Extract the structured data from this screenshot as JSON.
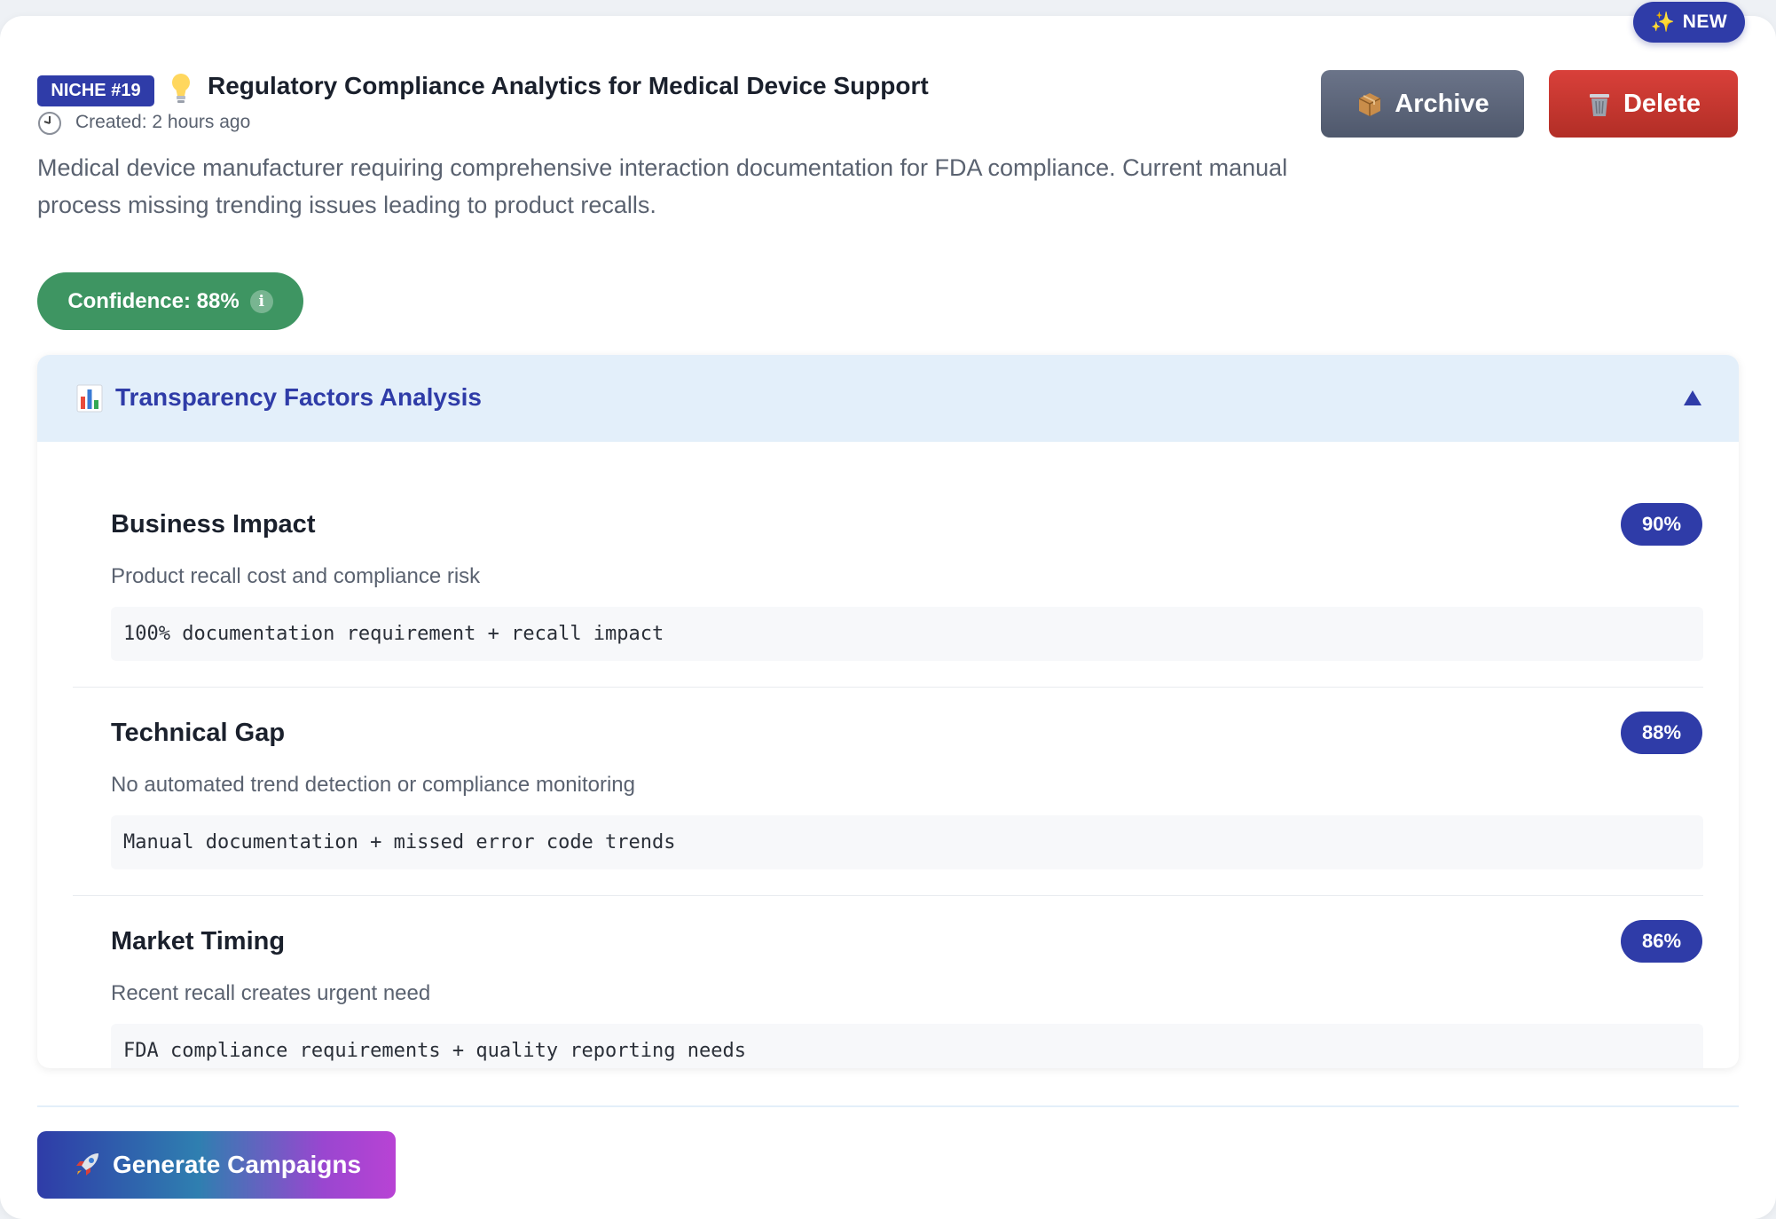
{
  "badge_new": "NEW",
  "niche": {
    "badge": "NICHE #19",
    "title": "Regulatory Compliance Analytics for Medical Device Support",
    "created": "Created: 2 hours ago"
  },
  "description": "Medical device manufacturer requiring comprehensive interaction documentation for FDA compliance. Current manual process missing trending issues leading to product recalls.",
  "actions": {
    "archive": "Archive",
    "delete": "Delete",
    "generate": "Generate Campaigns"
  },
  "confidence": {
    "label": "Confidence: 88%",
    "info": "i"
  },
  "panel": {
    "title": "Transparency Factors Analysis",
    "expanded": true,
    "factors": [
      {
        "name": "Business Impact",
        "score": "90%",
        "description": "Product recall cost and compliance risk",
        "evidence": "100% documentation requirement + recall impact"
      },
      {
        "name": "Technical Gap",
        "score": "88%",
        "description": "No automated trend detection or compliance monitoring",
        "evidence": "Manual documentation + missed error code trends"
      },
      {
        "name": "Market Timing",
        "score": "86%",
        "description": "Recent recall creates urgent need",
        "evidence": "FDA compliance requirements + quality reporting needs"
      }
    ]
  },
  "colors": {
    "primary": "#2f3ca8",
    "success": "#3e9562",
    "danger": "#c9362f",
    "archive": "#5d6679",
    "panel_header": "#e3effa"
  },
  "icons": {
    "new": "sparkle-icon",
    "niche": "lightbulb-icon",
    "created": "clock-icon",
    "archive": "package-icon",
    "delete": "trash-icon",
    "panel": "bar-chart-icon",
    "collapse": "triangle-up-icon",
    "generate": "rocket-icon"
  }
}
